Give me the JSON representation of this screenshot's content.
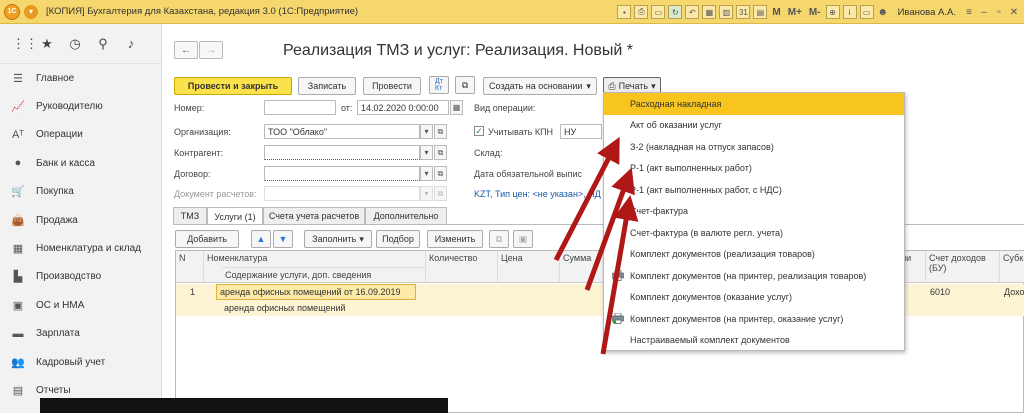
{
  "titlebar": {
    "logo": "1С",
    "title": "[КОПИЯ] Бухгалтерия для Казахстана, редакция 3.0  (1С:Предприятие)",
    "tools": [
      "M",
      "M+",
      "M-"
    ],
    "user": "Иванова А.А."
  },
  "sidebar": {
    "items": [
      {
        "label": "Главное",
        "icon": "menu-icon",
        "glyph": "☰"
      },
      {
        "label": "Руководителю",
        "icon": "chart-icon",
        "glyph": "📈"
      },
      {
        "label": "Операции",
        "icon": "operations-icon",
        "glyph": "Aᵀ"
      },
      {
        "label": "Банк и касса",
        "icon": "bank-icon",
        "glyph": "●"
      },
      {
        "label": "Покупка",
        "icon": "cart-icon",
        "glyph": "🛒"
      },
      {
        "label": "Продажа",
        "icon": "bag-icon",
        "glyph": "👜"
      },
      {
        "label": "Номенклатура и склад",
        "icon": "warehouse-icon",
        "glyph": "▦"
      },
      {
        "label": "Производство",
        "icon": "factory-icon",
        "glyph": "▙"
      },
      {
        "label": "ОС и НМА",
        "icon": "assets-icon",
        "glyph": "▣"
      },
      {
        "label": "Зарплата",
        "icon": "salary-icon",
        "glyph": "▬"
      },
      {
        "label": "Кадровый учет",
        "icon": "people-icon",
        "glyph": "👥"
      },
      {
        "label": "Отчеты",
        "icon": "reports-icon",
        "glyph": "▤"
      }
    ]
  },
  "form": {
    "title": "Реализация ТМЗ и услуг: Реализация. Новый *",
    "toolbar": {
      "post_close": "Провести и закрыть",
      "save": "Записать",
      "post": "Провести",
      "create_based": "Создать на основании",
      "print": "Печать"
    },
    "fields": {
      "number_label": "Номер:",
      "number_value": "",
      "date_label": "от:",
      "date_value": "14.02.2020  0:00:00",
      "operation_label": "Вид операции:",
      "org_label": "Организация:",
      "org_value": "ТОО \"Облако\"",
      "kpn_label": "Учитывать КПН",
      "kpn_value": "НУ",
      "contractor_label": "Контрагент:",
      "warehouse_label": "Склад:",
      "contract_label": "Договор:",
      "deadline_label": "Дата обязательной выпис",
      "settlement_label": "Документ расчетов:",
      "price_link": "KZT, Тип цен: <не указан>, НД"
    },
    "tabs": [
      "ТМЗ",
      "Услуги (1)",
      "Счета учета расчетов",
      "Дополнительно"
    ],
    "grid_toolbar": {
      "add": "Добавить",
      "fill": "Заполнить",
      "select": "Подбор",
      "change": "Изменить"
    },
    "grid": {
      "columns": {
        "n": "N",
        "nomenclature": "Номенклатура",
        "content": "Содержание услуги, доп. сведения",
        "quantity": "Количество",
        "price": "Цена",
        "sum": "Сумма",
        "tax_cut": "ции",
        "income_account": "Счет доходов (БУ)",
        "subconto": "Субк"
      },
      "rows": [
        {
          "n": "1",
          "nomenclature": "аренда офисных помещений от 16.09.2019",
          "content": "аренда офисных помещений",
          "income_account": "6010",
          "subconto": "Дохо"
        }
      ]
    }
  },
  "print_menu": {
    "items": [
      {
        "label": "Расходная накладная",
        "selected": true,
        "icon": ""
      },
      {
        "label": "Акт об оказании услуг",
        "selected": false,
        "icon": ""
      },
      {
        "label": "З-2 (накладная на отпуск запасов)",
        "selected": false,
        "icon": ""
      },
      {
        "label": "Р-1 (акт выполненных работ)",
        "selected": false,
        "icon": ""
      },
      {
        "label": "Р-1 (акт выполненных работ, с НДС)",
        "selected": false,
        "icon": ""
      },
      {
        "label": "Счет-фактура",
        "selected": false,
        "icon": ""
      },
      {
        "label": "Счет-фактура (в валюте регл. учета)",
        "selected": false,
        "icon": ""
      },
      {
        "label": "Комплект документов (реализация товаров)",
        "selected": false,
        "icon": ""
      },
      {
        "label": "Комплект документов (на принтер, реализация товаров)",
        "selected": false,
        "icon": "printer-icon"
      },
      {
        "label": "Комплект документов (оказание услуг)",
        "selected": false,
        "icon": ""
      },
      {
        "label": "Комплект документов (на принтер, оказание услуг)",
        "selected": false,
        "icon": "printer-icon"
      },
      {
        "label": "Настраиваемый комплект документов",
        "selected": false,
        "icon": ""
      }
    ]
  },
  "colors": {
    "accent": "#f7c51e",
    "titlebar": "#f5d76e",
    "arrow": "#b01818",
    "link": "#1a5aa8"
  }
}
